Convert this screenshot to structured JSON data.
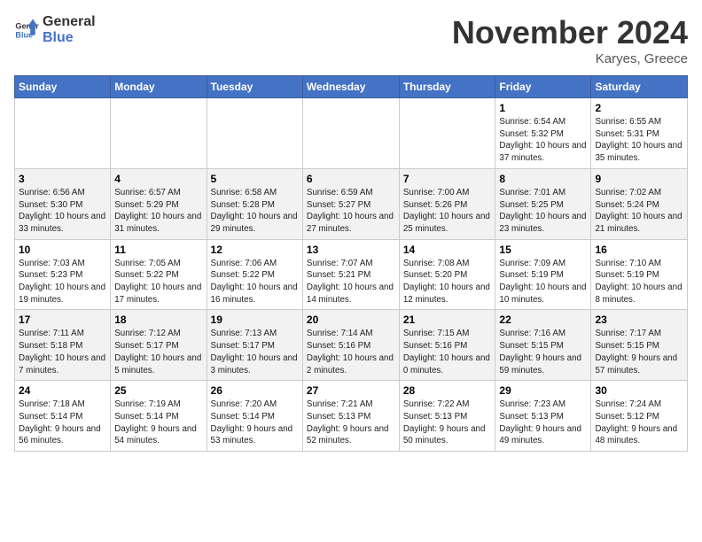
{
  "header": {
    "logo_general": "General",
    "logo_blue": "Blue",
    "title": "November 2024",
    "location": "Karyes, Greece"
  },
  "days_of_week": [
    "Sunday",
    "Monday",
    "Tuesday",
    "Wednesday",
    "Thursday",
    "Friday",
    "Saturday"
  ],
  "weeks": [
    [
      {
        "day": "",
        "info": ""
      },
      {
        "day": "",
        "info": ""
      },
      {
        "day": "",
        "info": ""
      },
      {
        "day": "",
        "info": ""
      },
      {
        "day": "",
        "info": ""
      },
      {
        "day": "1",
        "info": "Sunrise: 6:54 AM\nSunset: 5:32 PM\nDaylight: 10 hours\nand 37 minutes."
      },
      {
        "day": "2",
        "info": "Sunrise: 6:55 AM\nSunset: 5:31 PM\nDaylight: 10 hours\nand 35 minutes."
      }
    ],
    [
      {
        "day": "3",
        "info": "Sunrise: 6:56 AM\nSunset: 5:30 PM\nDaylight: 10 hours\nand 33 minutes."
      },
      {
        "day": "4",
        "info": "Sunrise: 6:57 AM\nSunset: 5:29 PM\nDaylight: 10 hours\nand 31 minutes."
      },
      {
        "day": "5",
        "info": "Sunrise: 6:58 AM\nSunset: 5:28 PM\nDaylight: 10 hours\nand 29 minutes."
      },
      {
        "day": "6",
        "info": "Sunrise: 6:59 AM\nSunset: 5:27 PM\nDaylight: 10 hours\nand 27 minutes."
      },
      {
        "day": "7",
        "info": "Sunrise: 7:00 AM\nSunset: 5:26 PM\nDaylight: 10 hours\nand 25 minutes."
      },
      {
        "day": "8",
        "info": "Sunrise: 7:01 AM\nSunset: 5:25 PM\nDaylight: 10 hours\nand 23 minutes."
      },
      {
        "day": "9",
        "info": "Sunrise: 7:02 AM\nSunset: 5:24 PM\nDaylight: 10 hours\nand 21 minutes."
      }
    ],
    [
      {
        "day": "10",
        "info": "Sunrise: 7:03 AM\nSunset: 5:23 PM\nDaylight: 10 hours\nand 19 minutes."
      },
      {
        "day": "11",
        "info": "Sunrise: 7:05 AM\nSunset: 5:22 PM\nDaylight: 10 hours\nand 17 minutes."
      },
      {
        "day": "12",
        "info": "Sunrise: 7:06 AM\nSunset: 5:22 PM\nDaylight: 10 hours\nand 16 minutes."
      },
      {
        "day": "13",
        "info": "Sunrise: 7:07 AM\nSunset: 5:21 PM\nDaylight: 10 hours\nand 14 minutes."
      },
      {
        "day": "14",
        "info": "Sunrise: 7:08 AM\nSunset: 5:20 PM\nDaylight: 10 hours\nand 12 minutes."
      },
      {
        "day": "15",
        "info": "Sunrise: 7:09 AM\nSunset: 5:19 PM\nDaylight: 10 hours\nand 10 minutes."
      },
      {
        "day": "16",
        "info": "Sunrise: 7:10 AM\nSunset: 5:19 PM\nDaylight: 10 hours\nand 8 minutes."
      }
    ],
    [
      {
        "day": "17",
        "info": "Sunrise: 7:11 AM\nSunset: 5:18 PM\nDaylight: 10 hours\nand 7 minutes."
      },
      {
        "day": "18",
        "info": "Sunrise: 7:12 AM\nSunset: 5:17 PM\nDaylight: 10 hours\nand 5 minutes."
      },
      {
        "day": "19",
        "info": "Sunrise: 7:13 AM\nSunset: 5:17 PM\nDaylight: 10 hours\nand 3 minutes."
      },
      {
        "day": "20",
        "info": "Sunrise: 7:14 AM\nSunset: 5:16 PM\nDaylight: 10 hours\nand 2 minutes."
      },
      {
        "day": "21",
        "info": "Sunrise: 7:15 AM\nSunset: 5:16 PM\nDaylight: 10 hours\nand 0 minutes."
      },
      {
        "day": "22",
        "info": "Sunrise: 7:16 AM\nSunset: 5:15 PM\nDaylight: 9 hours\nand 59 minutes."
      },
      {
        "day": "23",
        "info": "Sunrise: 7:17 AM\nSunset: 5:15 PM\nDaylight: 9 hours\nand 57 minutes."
      }
    ],
    [
      {
        "day": "24",
        "info": "Sunrise: 7:18 AM\nSunset: 5:14 PM\nDaylight: 9 hours\nand 56 minutes."
      },
      {
        "day": "25",
        "info": "Sunrise: 7:19 AM\nSunset: 5:14 PM\nDaylight: 9 hours\nand 54 minutes."
      },
      {
        "day": "26",
        "info": "Sunrise: 7:20 AM\nSunset: 5:14 PM\nDaylight: 9 hours\nand 53 minutes."
      },
      {
        "day": "27",
        "info": "Sunrise: 7:21 AM\nSunset: 5:13 PM\nDaylight: 9 hours\nand 52 minutes."
      },
      {
        "day": "28",
        "info": "Sunrise: 7:22 AM\nSunset: 5:13 PM\nDaylight: 9 hours\nand 50 minutes."
      },
      {
        "day": "29",
        "info": "Sunrise: 7:23 AM\nSunset: 5:13 PM\nDaylight: 9 hours\nand 49 minutes."
      },
      {
        "day": "30",
        "info": "Sunrise: 7:24 AM\nSunset: 5:12 PM\nDaylight: 9 hours\nand 48 minutes."
      }
    ]
  ]
}
